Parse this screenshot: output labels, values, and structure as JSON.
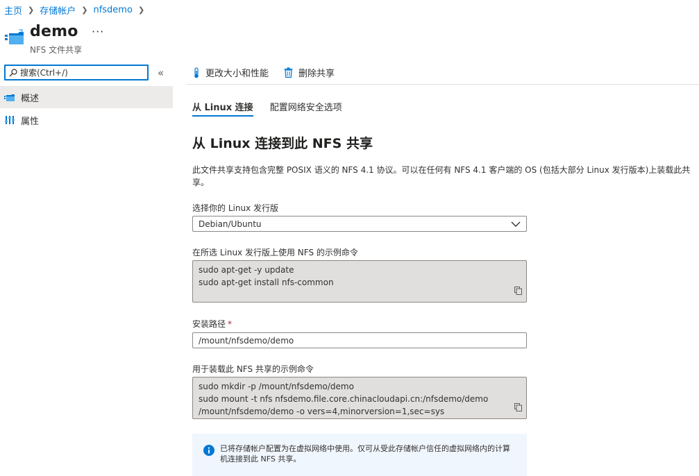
{
  "breadcrumb": [
    "主页",
    "存储帐户",
    "nfsdemo"
  ],
  "header": {
    "title": "demo",
    "subtitle": "NFS 文件共享",
    "more": "···"
  },
  "search": {
    "placeholder": "搜索(Ctrl+/)"
  },
  "sidebar": {
    "collapse": "«",
    "items": [
      {
        "label": "概述",
        "icon": "file-share-icon",
        "active": true
      },
      {
        "label": "属性",
        "icon": "properties-icon",
        "active": false
      }
    ]
  },
  "toolbar": {
    "resize_label": "更改大小和性能",
    "delete_label": "删除共享"
  },
  "tabs": [
    {
      "label": "从 Linux 连接",
      "active": true
    },
    {
      "label": "配置网络安全选项",
      "active": false
    }
  ],
  "main": {
    "section_title": "从 Linux 连接到此 NFS 共享",
    "description": "此文件共享支持包含完整 POSIX 语义的 NFS 4.1 协议。可以在任何有 NFS 4.1 客户端的 OS (包括大部分 Linux 发行版本)上装载此共享。",
    "distro_label": "选择你的 Linux 发行版",
    "distro_value": "Debian/Ubuntu",
    "sample_cmd_label": "在所选 Linux 发行版上使用 NFS 的示例命令",
    "sample_cmd_lines": [
      "sudo apt-get -y update",
      "sudo apt-get install nfs-common"
    ],
    "mount_path_label": "安装路径",
    "mount_path_required": "*",
    "mount_path_value": "/mount/nfsdemo/demo",
    "mount_cmd_label": "用于装载此 NFS 共享的示例命令",
    "mount_cmd_lines": [
      "sudo mkdir -p /mount/nfsdemo/demo",
      "sudo mount -t nfs nfsdemo.file.core.chinacloudapi.cn:/nfsdemo/demo",
      "/mount/nfsdemo/demo -o vers=4,minorversion=1,sec=sys"
    ],
    "info_text": "已将存储帐户配置为在虚拟网络中使用。仅可从受此存储帐户信任的虚拟网络内的计算机连接到此 NFS 共享。"
  },
  "colors": {
    "accent": "#0078d4",
    "required": "#a4262c",
    "info_bg": "#f0f6fd"
  }
}
